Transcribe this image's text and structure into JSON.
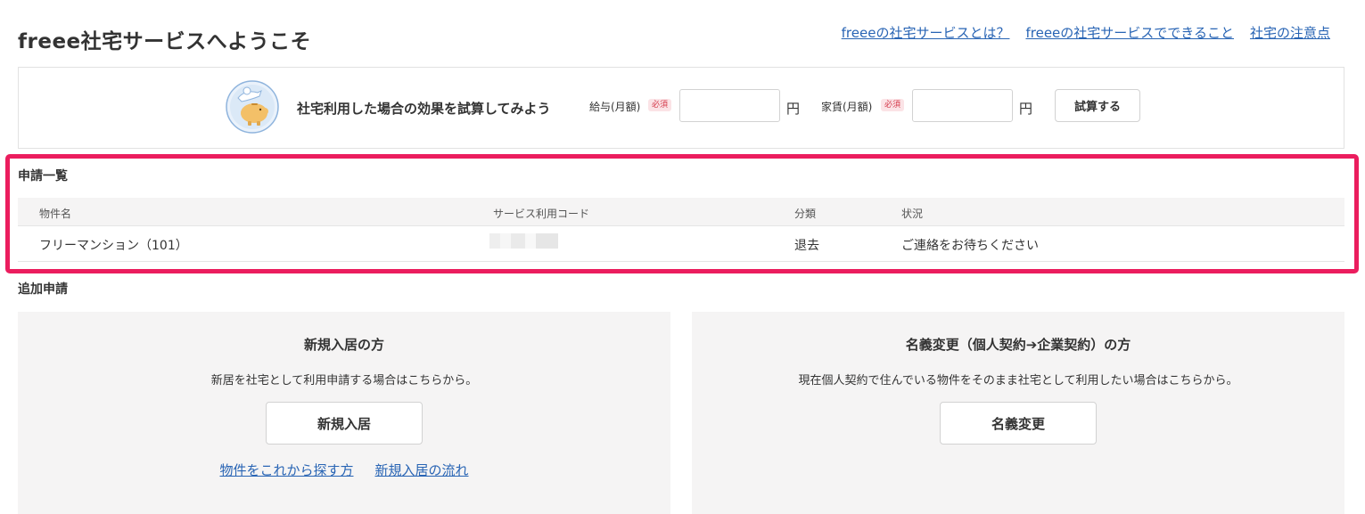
{
  "header": {
    "title": "freee社宅サービスへようこそ",
    "links": [
      "freeeの社宅サービスとは？",
      "freeeの社宅サービスでできること",
      "社宅の注意点"
    ]
  },
  "simulator": {
    "icon": "piggy-bank-icon",
    "heading": "社宅利用した場合の効果を試算してみよう",
    "salary_label": "給与(月額)",
    "rent_label": "家賃(月額)",
    "required_badge": "必須",
    "salary_value": "",
    "rent_value": "",
    "currency": "円",
    "calc_button": "試算する"
  },
  "applications": {
    "heading": "申請一覧",
    "columns": [
      "物件名",
      "サービス利用コード",
      "分類",
      "状況"
    ],
    "rows": [
      {
        "property": "フリーマンション（101）",
        "category": "退去",
        "status": "ご連絡をお待ちください"
      }
    ]
  },
  "additional": {
    "heading": "追加申請",
    "new_move_in": {
      "title": "新規入居の方",
      "description": "新居を社宅として利用申請する場合はこちらから。",
      "button": "新規入居",
      "links": [
        "物件をこれから探す方",
        "新規入居の流れ"
      ]
    },
    "name_change": {
      "title": "名義変更（個人契約➔企業契約）の方",
      "description": "現在個人契約で住んでいる物件をそのまま社宅として利用したい場合はこちらから。",
      "button": "名義変更"
    }
  },
  "colors": {
    "link": "#2864b4",
    "highlight": "#eb1d5e",
    "required_badge": "#d4394a"
  }
}
